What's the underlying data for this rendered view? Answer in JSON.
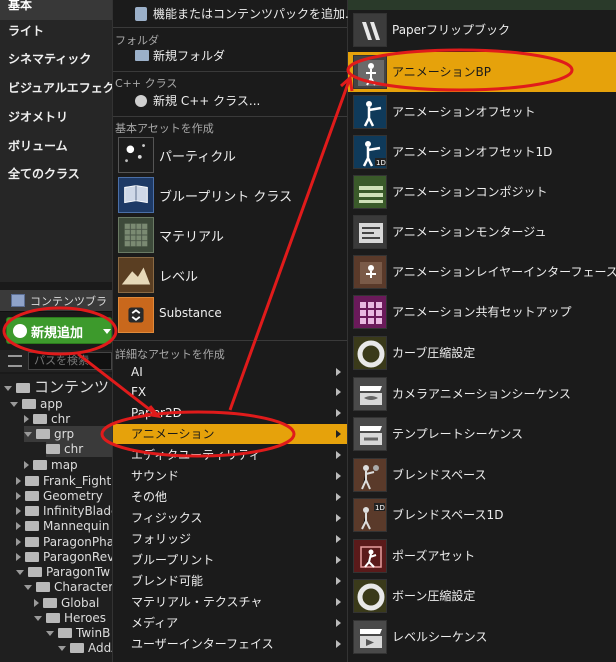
{
  "left": {
    "categories": [
      "基本",
      "ライト",
      "シネマティック",
      "ビジュアルエフェクト",
      "ジオメトリ",
      "ボリューム",
      "全てのクラス"
    ],
    "content_browser_title": "コンテンツブラ",
    "new_button_label": "新規追加",
    "search_placeholder": "パスを検索",
    "tree": [
      "コンテンツ",
      "app",
      "chr",
      "grp",
      "chr",
      "map",
      "Frank_Fight",
      "Geometry",
      "InfinityBlade",
      "Mannequin",
      "ParagonPha",
      "ParagonRev",
      "ParagonTw",
      "Character",
      "Global",
      "Heroes",
      "TwinB",
      "AddA"
    ]
  },
  "middle": {
    "top_item": "機能またはコンテンツパックを追加...",
    "folder_header": "フォルダ",
    "new_folder": "新規フォルダ",
    "cpp_header": "C++ クラス",
    "new_cpp": "新規 C++ クラス...",
    "basic_header": "基本アセットを作成",
    "basic_items": [
      "パーティクル",
      "ブループリント クラス",
      "マテリアル",
      "レベル",
      "Substance"
    ],
    "advanced_header": "詳細なアセットを作成",
    "advanced_items": [
      "AI",
      "FX",
      "Paper2D",
      "アニメーション",
      "エディタユーティリティ",
      "サウンド",
      "その他",
      "フィジックス",
      "フォリッジ",
      "ブループリント",
      "ブレンド可能",
      "マテリアル・テクスチャ",
      "メディア",
      "ユーザーインターフェイス"
    ]
  },
  "right": {
    "items": [
      "Paperフリップブック",
      "アニメーションBP",
      "アニメーションオフセット",
      "アニメーションオフセット1D",
      "アニメーションコンポジット",
      "アニメーションモンタージュ",
      "アニメーションレイヤーインターフェース",
      "アニメーション共有セットアップ",
      "カーブ圧縮設定",
      "カメラアニメーションシーケンス",
      "テンプレートシーケンス",
      "ブレンドスペース",
      "ブレンドスペース1D",
      "ポーズアセット",
      "ボーン圧縮設定",
      "レベルシーケンス"
    ]
  },
  "colors": {
    "accent": "#e6a20b",
    "new_button": "#3d9a2c",
    "annotation": "#e01b1b"
  }
}
